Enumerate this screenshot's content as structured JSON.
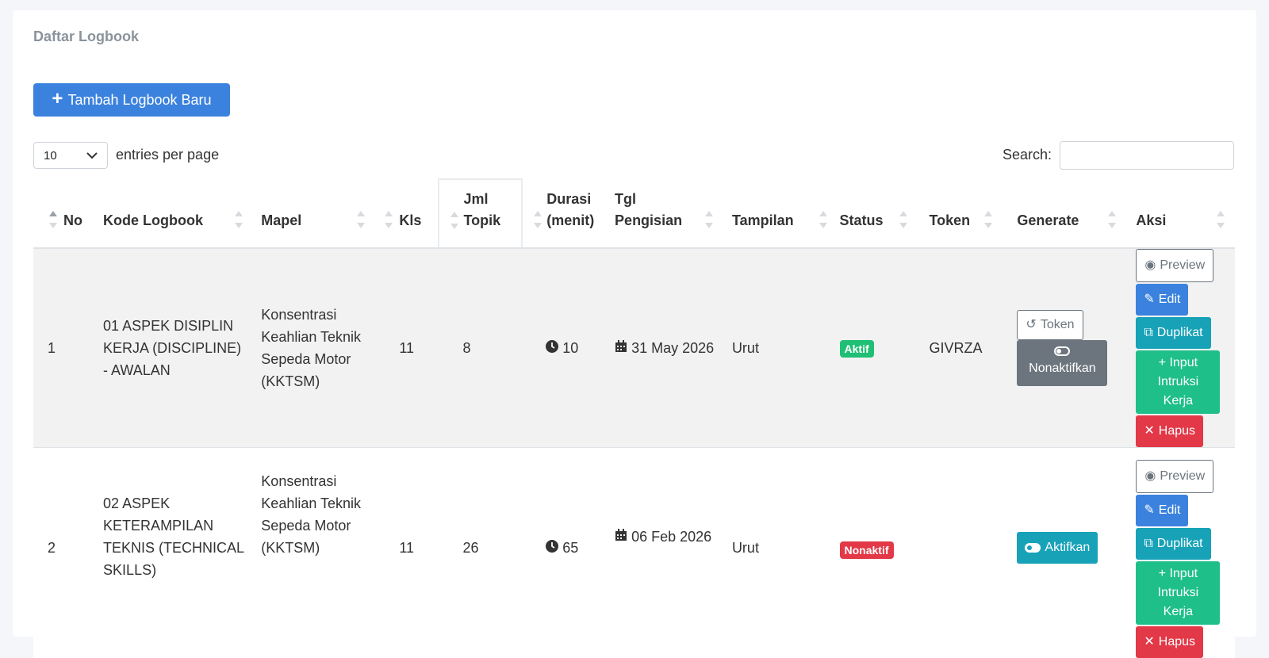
{
  "title": "Daftar Logbook",
  "add_button": "Tambah Logbook Baru",
  "per_page": {
    "value": "10",
    "label": "entries per page"
  },
  "search": {
    "label": "Search:",
    "value": ""
  },
  "columns": [
    "No",
    "Kode Logbook",
    "Mapel",
    "Kls",
    "Jml Topik",
    "Durasi (menit)",
    "Tgl Pengisian",
    "Tampilan",
    "Status",
    "Token",
    "Generate",
    "Aksi"
  ],
  "rows": [
    {
      "no": "1",
      "kode": "01 ASPEK DISIPLIN KERJA (DISCIPLINE) - AWALAN",
      "mapel": "Konsentrasi Keahlian Teknik Sepeda Motor (KKTSM)",
      "kls": "11",
      "topik": "8",
      "durasi": "10",
      "tgl": "31 May 2026",
      "tampilan": "Urut",
      "status": "Aktif",
      "token": "GIVRZA",
      "generate": {
        "token_btn": "Token",
        "toggle_btn": "Nonaktifkan"
      },
      "aksi": {
        "preview": "Preview",
        "edit": "Edit",
        "duplikat": "Duplikat",
        "input": "Input Intruksi Kerja",
        "hapus": "Hapus"
      }
    },
    {
      "no": "2",
      "kode": "02 ASPEK KETERAMPILAN TEKNIS (TECHNICAL SKILLS)",
      "mapel": "Konsentrasi Keahlian Teknik Sepeda Motor (KKTSM)",
      "kls": "11",
      "topik": "26",
      "durasi": "65",
      "tgl": "06 Feb 2026",
      "tampilan": "Urut",
      "status": "Nonaktif",
      "token": "",
      "generate": {
        "toggle_btn": "Aktifkan"
      },
      "aksi": {
        "preview": "Preview",
        "edit": "Edit",
        "duplikat": "Duplikat",
        "input": "Input Intruksi Kerja",
        "hapus": "Hapus"
      }
    }
  ],
  "colors": {
    "primary": "#3b82de",
    "success": "#1fbf75",
    "danger": "#e23847",
    "info": "#17a2b8",
    "secondary": "#6c757d"
  }
}
